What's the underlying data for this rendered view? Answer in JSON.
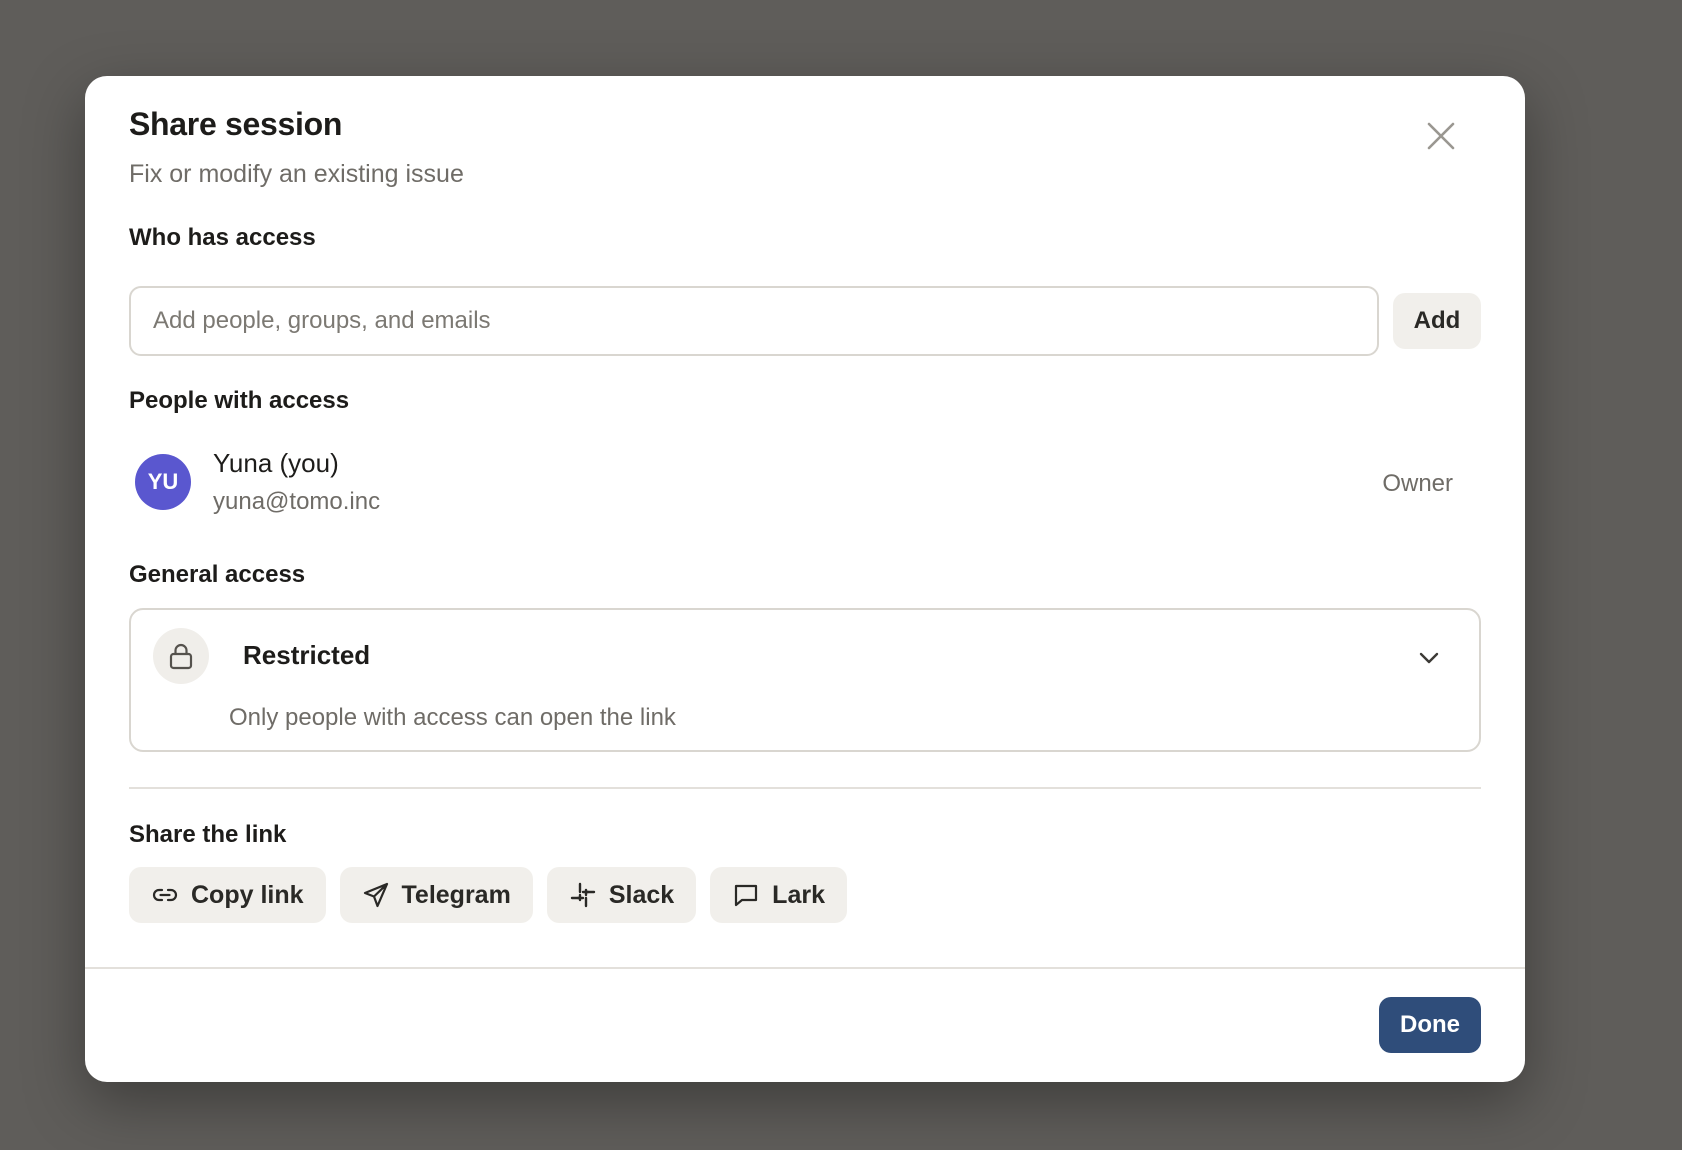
{
  "dialog": {
    "title": "Share session",
    "subtitle": "Fix or modify an existing issue",
    "close_icon": "close-icon"
  },
  "who_has_access": {
    "label": "Who has access",
    "input_placeholder": "Add people, groups, and emails",
    "input_value": "",
    "add_label": "Add"
  },
  "people": {
    "label": "People with access",
    "items": [
      {
        "initials": "YU",
        "name": "Yuna (you)",
        "email": "yuna@tomo.inc",
        "role": "Owner",
        "avatar_color": "#5a57cf"
      }
    ]
  },
  "general_access": {
    "label": "General access",
    "icon": "lock-icon",
    "selected": "Restricted",
    "description": "Only people with access can open the link"
  },
  "share_link": {
    "label": "Share the link",
    "buttons": [
      {
        "label": "Copy link",
        "icon": "link-icon"
      },
      {
        "label": "Telegram",
        "icon": "send-icon"
      },
      {
        "label": "Slack",
        "icon": "slack-icon"
      },
      {
        "label": "Lark",
        "icon": "chat-icon"
      }
    ]
  },
  "footer": {
    "done_label": "Done"
  },
  "colors": {
    "primary": "#2f4d7a",
    "backdrop": "#5f5d5a",
    "avatar": "#5a57cf"
  }
}
